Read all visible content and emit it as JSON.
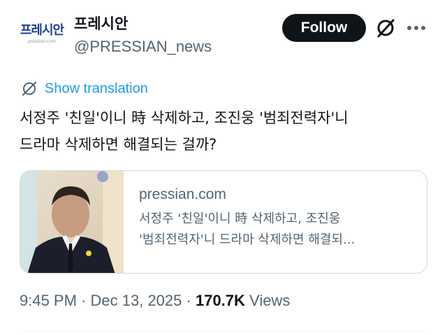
{
  "account": {
    "display_name": "프레시안",
    "handle": "@PRESSIAN_news",
    "avatar_logo_text": "프레시안",
    "avatar_logo_subtext": "pressian.com"
  },
  "header": {
    "follow_label": "Follow",
    "grok_icon": "grok-slash-icon",
    "more_icon": "more-dots-icon"
  },
  "translate": {
    "icon": "globe-icon",
    "label": "Show translation"
  },
  "tweet": {
    "text": "서정주 '친일'이니 時 삭제하고, 조진웅 '범죄전력자'니\n드라마 삭제하면 해결되는 걸까?"
  },
  "card": {
    "domain": "pressian.com",
    "title": "서정주 '친일'이니 時 삭제하고, 조진웅\n'범죄전력자'니 드라마 삭제하면 해결되..."
  },
  "meta": {
    "time": "9:45 PM",
    "separator": "·",
    "date": "Dec 13, 2025",
    "views_count": "170.7K",
    "views_label": "Views"
  },
  "colors": {
    "follow_bg": "#0f1419",
    "link_blue": "#1d9bf0",
    "secondary_text": "#536471",
    "border": "#cfd9de",
    "logo_blue": "#1d3f8f"
  }
}
